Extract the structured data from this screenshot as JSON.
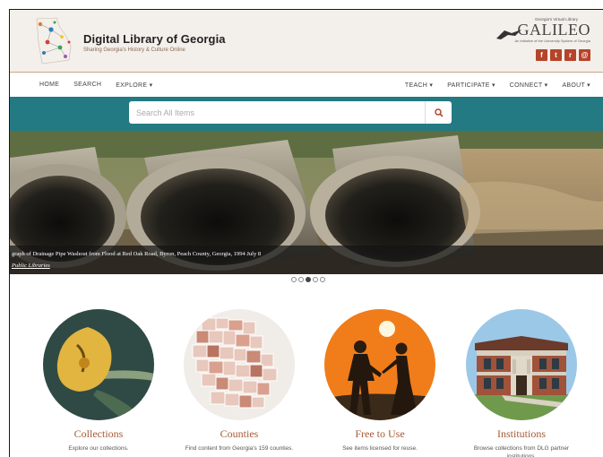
{
  "header": {
    "title": "Digital Library of Georgia",
    "subtitle": "Sharing Georgia's History & Culture Online",
    "galileo": {
      "small_text": "Georgia's Virtual Library",
      "wordmark": "GALILEO",
      "tagline": "An initiative of the University System of Georgia"
    },
    "social": [
      {
        "icon": "facebook-icon",
        "glyph": "f"
      },
      {
        "icon": "twitter-icon",
        "glyph": "t"
      },
      {
        "icon": "rss-icon",
        "glyph": "r"
      },
      {
        "icon": "email-icon",
        "glyph": "@"
      }
    ],
    "accent": "#b5442a"
  },
  "nav": {
    "left": [
      "HOME",
      "SEARCH",
      "EXPLORE ▾"
    ],
    "right": [
      "TEACH ▾",
      "PARTICIPATE ▾",
      "CONNECT ▾",
      "ABOUT ▾"
    ]
  },
  "search": {
    "placeholder": "Search All Items",
    "icon": "search-icon",
    "band_color": "#237a82"
  },
  "hero": {
    "caption": "graph of Drainage Pipe Washout from Flood at Red Oak Road, Byron, Peach County, Georgia, 1994 July 8",
    "source": "Public Libraries",
    "slides": 5,
    "active_slide": 3
  },
  "features": [
    {
      "title": "Collections",
      "description": "Explore our collections."
    },
    {
      "title": "Counties",
      "description": "Find content from Georgia's 159 counties."
    },
    {
      "title": "Free to Use",
      "description": "See items licensed for reuse."
    },
    {
      "title": "Institutions",
      "description": "Browse collections from DLG partner institutions."
    }
  ]
}
